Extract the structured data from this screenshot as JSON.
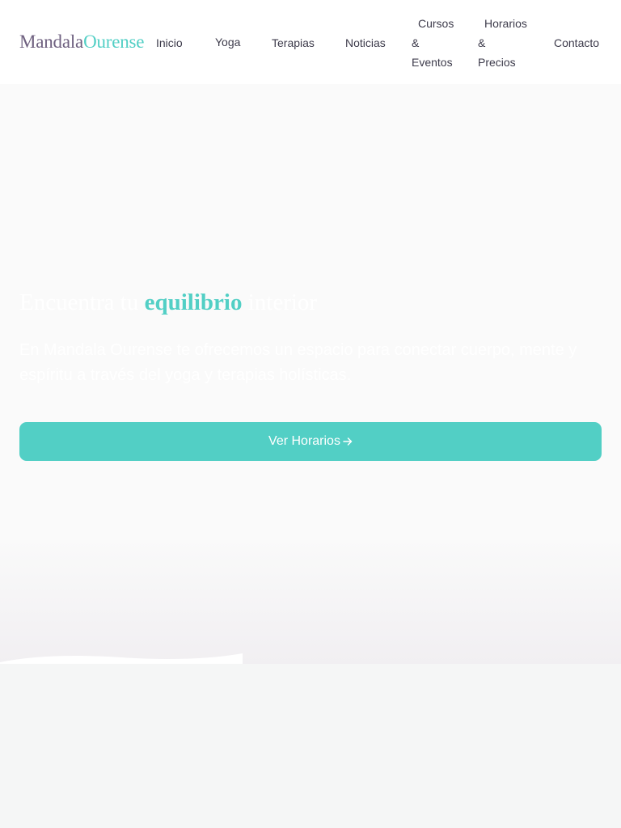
{
  "header": {
    "logo": {
      "part1": "Mandala",
      "part2": "Ourense"
    },
    "nav": [
      {
        "label": "Inicio"
      },
      {
        "label": "Yoga"
      },
      {
        "label": "Terapias"
      },
      {
        "label": "Noticias"
      },
      {
        "lines": [
          "Cursos",
          "&",
          "Eventos"
        ]
      },
      {
        "lines": [
          "Horarios",
          "&",
          "Precios"
        ]
      },
      {
        "label": "Contacto"
      }
    ]
  },
  "hero": {
    "title": {
      "before": "Encuentra tu ",
      "accent": "equilibrio",
      "after": " interior"
    },
    "text": "En Mandala Ourense te ofrecemos un espacio para conectar cuerpo, mente y espíritu a través del yoga y terapias holísticas.",
    "cta": {
      "label": "Ver Horarios",
      "icon": "arrow-right-icon"
    }
  },
  "colors": {
    "accent": "#52cfc5",
    "logo_primary": "#6f6180",
    "nav_text": "#3d3b4b"
  }
}
